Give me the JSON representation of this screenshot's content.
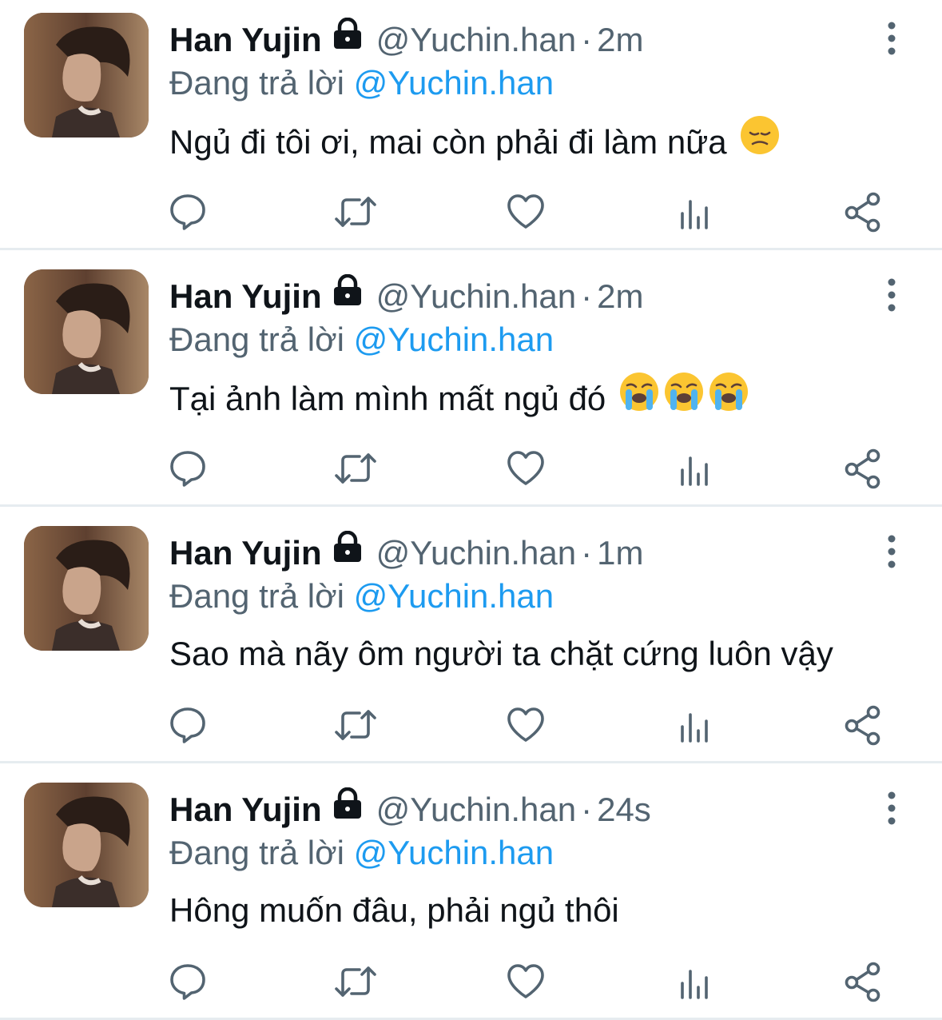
{
  "tweets": [
    {
      "display_name": "Han Yujin",
      "handle": "@Yuchin.han",
      "separator": "·",
      "time": "2m",
      "reply_prefix": "Đang trả lời",
      "reply_to": "@Yuchin.han",
      "text": "Ngủ đi tôi ơi, mai còn phải đi làm nữa",
      "emojis": [
        "disappointed-face-emoji"
      ]
    },
    {
      "display_name": "Han Yujin",
      "handle": "@Yuchin.han",
      "separator": "·",
      "time": "2m",
      "reply_prefix": "Đang trả lời",
      "reply_to": "@Yuchin.han",
      "text": "Tại ảnh làm mình mất ngủ đó",
      "emojis": [
        "loudly-crying-face-emoji",
        "loudly-crying-face-emoji",
        "loudly-crying-face-emoji"
      ]
    },
    {
      "display_name": "Han Yujin",
      "handle": "@Yuchin.han",
      "separator": "·",
      "time": "1m",
      "reply_prefix": "Đang trả lời",
      "reply_to": "@Yuchin.han",
      "text": "Sao mà nãy ôm người ta chặt cứng luôn vậy",
      "emojis": []
    },
    {
      "display_name": "Han Yujin",
      "handle": "@Yuchin.han",
      "separator": "·",
      "time": "24s",
      "reply_prefix": "Đang trả lời",
      "reply_to": "@Yuchin.han",
      "text": "Hông muốn đâu, phải ngủ thôi",
      "emojis": []
    }
  ],
  "actions": [
    "reply-icon",
    "retweet-icon",
    "like-icon",
    "analytics-icon",
    "share-icon"
  ],
  "colors": {
    "text": "#0f1419",
    "secondary": "#536471",
    "mention": "#1d9bf0",
    "divider": "#e6ecf0",
    "icon": "#536471"
  }
}
